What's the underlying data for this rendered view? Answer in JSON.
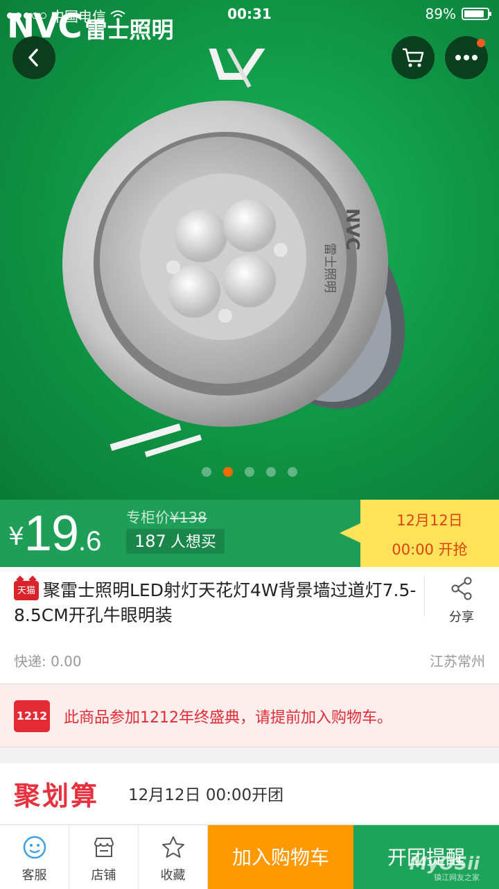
{
  "status_bar": {
    "carrier": "中国电信",
    "time": "00:31",
    "battery_percent": "89%",
    "battery_level": 0.89
  },
  "hero": {
    "brand_latin": "NVC",
    "brand_cn": "雷士照明",
    "carousel_total": 5,
    "carousel_active_index": 1,
    "icons": {
      "back": "chevron-left-icon",
      "cart": "cart-icon",
      "more": "more-dots-icon"
    }
  },
  "price": {
    "currency": "¥",
    "integer": "19",
    "decimal": ".6",
    "original_label": "专柜价",
    "original_price": "¥138",
    "wants_count": "187",
    "wants_label": "人想买",
    "countdown_date": "12月12日",
    "countdown_time": "00:00 开抢"
  },
  "product": {
    "badge": "天猫",
    "title": "聚雷士照明LED射灯天花灯4W背景墙过道灯7.5-8.5CM开孔牛眼明装",
    "share_label": "分享",
    "shipping": "快递: 0.00",
    "location": "江苏常州"
  },
  "promo": {
    "icon_text": "1212",
    "text": "此商品参加1212年终盛典，请提前加入购物车。"
  },
  "ju": {
    "logo": "聚划算",
    "time": "12月12日 00:00开团"
  },
  "bottom_bar": {
    "service": "客服",
    "store": "店铺",
    "favorite": "收藏",
    "add_cart": "加入购物车",
    "remind": "开团提醒"
  },
  "watermark": {
    "main": "MyOSii",
    "sub": "镇江网友之家"
  },
  "colors": {
    "hero_green": "#119a48",
    "price_green": "#1f9e57",
    "countdown_yellow": "#fde25a",
    "accent_orange": "#ff9900",
    "remind_green": "#1da35a",
    "promo_red": "#e42a34"
  }
}
